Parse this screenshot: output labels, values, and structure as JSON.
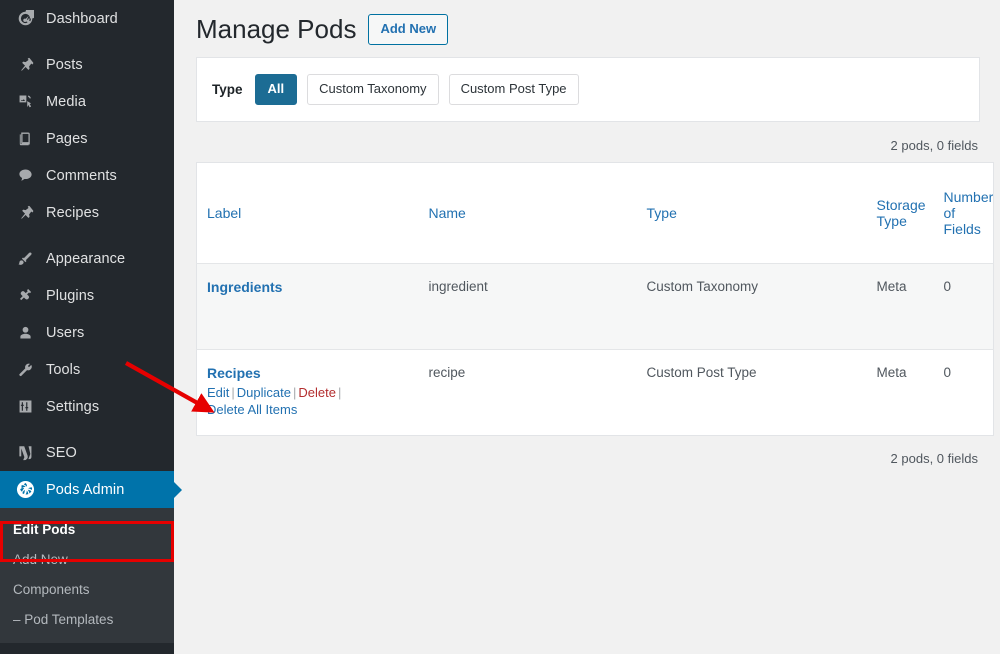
{
  "sidebar": {
    "items": [
      {
        "label": "Dashboard",
        "icon": "dashboard-icon",
        "gap_after": true
      },
      {
        "label": "Posts",
        "icon": "pin-icon",
        "gap_after": false
      },
      {
        "label": "Media",
        "icon": "media-icon",
        "gap_after": false
      },
      {
        "label": "Pages",
        "icon": "pages-icon",
        "gap_after": false
      },
      {
        "label": "Comments",
        "icon": "comment-icon",
        "gap_after": false
      },
      {
        "label": "Recipes",
        "icon": "pin-icon",
        "gap_after": true
      },
      {
        "label": "Appearance",
        "icon": "brush-icon",
        "gap_after": false
      },
      {
        "label": "Plugins",
        "icon": "plugin-icon",
        "gap_after": false
      },
      {
        "label": "Users",
        "icon": "user-icon",
        "gap_after": false
      },
      {
        "label": "Tools",
        "icon": "wrench-icon",
        "gap_after": false
      },
      {
        "label": "Settings",
        "icon": "sliders-icon",
        "gap_after": true
      },
      {
        "label": "SEO",
        "icon": "yoast-icon",
        "gap_after": false
      }
    ],
    "pods_admin": {
      "label": "Pods Admin",
      "icon": "pods-logo-icon",
      "active": true
    },
    "submenu": [
      {
        "label": "Edit Pods",
        "current": true
      },
      {
        "label": "Add New",
        "current": false
      },
      {
        "label": "Components",
        "current": false
      },
      {
        "label": "– Pod Templates",
        "current": false
      }
    ]
  },
  "header": {
    "title": "Manage Pods",
    "add_new_label": "Add New"
  },
  "filter": {
    "label": "Type",
    "options": [
      {
        "label": "All",
        "active": true
      },
      {
        "label": "Custom Taxonomy",
        "active": false
      },
      {
        "label": "Custom Post Type",
        "active": false
      }
    ]
  },
  "counts": {
    "top": "2 pods, 0 fields",
    "bottom": "2 pods, 0 fields"
  },
  "table": {
    "columns": [
      {
        "label": "Label"
      },
      {
        "label": "Name"
      },
      {
        "label": "Type"
      },
      {
        "label": "Storage Type"
      },
      {
        "label": "Number of Fields"
      }
    ],
    "rows": [
      {
        "label": "Ingredients",
        "name": "ingredient",
        "type": "Custom Taxonomy",
        "storage_type": "Meta",
        "number_of_fields": "0",
        "actions": []
      },
      {
        "label": "Recipes",
        "name": "recipe",
        "type": "Custom Post Type",
        "storage_type": "Meta",
        "number_of_fields": "0",
        "actions": [
          {
            "label": "Edit",
            "kind": "link"
          },
          {
            "label": "Duplicate",
            "kind": "link"
          },
          {
            "label": "Delete",
            "kind": "danger"
          },
          {
            "label": "Delete All Items",
            "kind": "link"
          }
        ]
      }
    ]
  },
  "annotations": {
    "arrow_target": "Edit",
    "highlight_target": "Edit Pods",
    "color": "#e60000"
  }
}
